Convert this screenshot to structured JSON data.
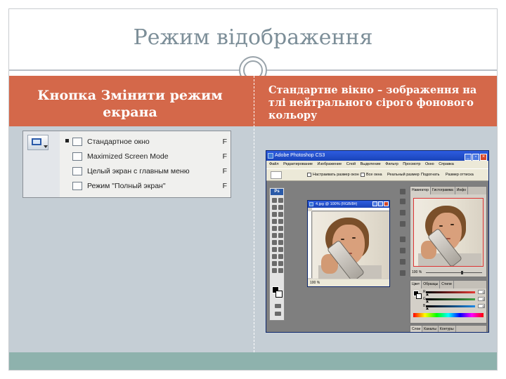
{
  "slide": {
    "title": "Режим відображення",
    "left_heading": "Кнопка Змінити режим екрана",
    "right_heading": "Стандартне вікно – зображення на тлі нейтрального сірого фонового кольору"
  },
  "screen_mode_menu": {
    "items": [
      {
        "label": "Стандартное окно",
        "shortcut": "F",
        "selected": true
      },
      {
        "label": "Maximized Screen Mode",
        "shortcut": "F",
        "selected": false
      },
      {
        "label": "Целый экран с главным меню",
        "shortcut": "F",
        "selected": false
      },
      {
        "label": "Режим \"Полный экран\"",
        "shortcut": "F",
        "selected": false
      }
    ]
  },
  "photoshop": {
    "window_title": "Adobe Photoshop CS3",
    "menu": [
      "Файл",
      "Редактирование",
      "Изображение",
      "Слой",
      "Выделение",
      "Фильтр",
      "Просмотр",
      "Окно",
      "Справка"
    ],
    "options_bar": {
      "fit_window": "Настраивать размер окон",
      "all_windows": "Все окна",
      "actual_pixels": "Реальный размер",
      "fit_screen": "Подогнать",
      "print_size": "Размер оттиска"
    },
    "toolbox_label": "Ps",
    "document": {
      "title": "4.jpg @ 100% (RGB/8#)",
      "zoom": "100 %"
    },
    "navigator": {
      "tabs": [
        "Навигатор",
        "Гистограмма",
        "Инфо"
      ],
      "zoom": "100 %"
    },
    "color_panel": {
      "tabs": [
        "Цвет",
        "Образцы",
        "Стили"
      ],
      "channels": [
        {
          "label": "R",
          "value": "0",
          "color": "#e53935"
        },
        {
          "label": "G",
          "value": "0",
          "color": "#43a047"
        },
        {
          "label": "B",
          "value": "0",
          "color": "#1e88e5"
        }
      ]
    },
    "layers_panel": {
      "tabs": [
        "Слои",
        "Каналы",
        "Контуры"
      ]
    }
  },
  "colors": {
    "header_band": "#d4684a",
    "content_band": "#c5ced5",
    "footer_band": "#8eb2ad",
    "title_text": "#7c8e98"
  }
}
